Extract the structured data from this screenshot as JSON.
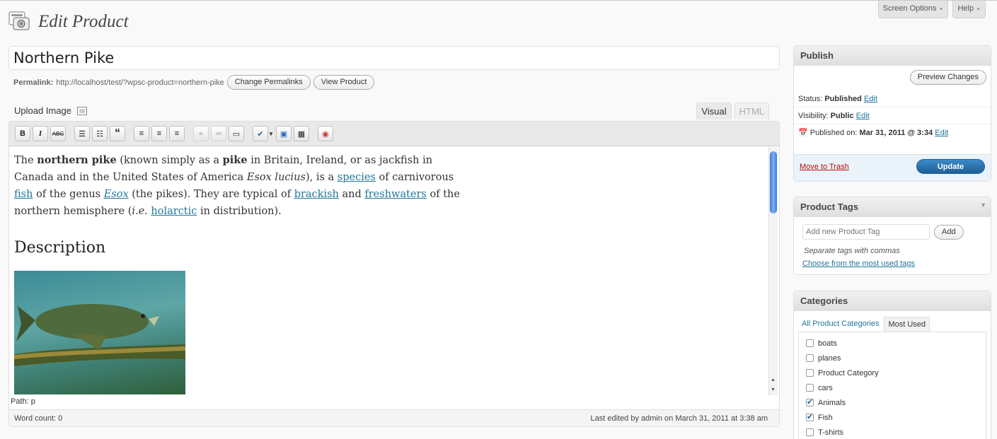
{
  "header": {
    "screen_options": "Screen Options",
    "help": "Help",
    "title": "Edit Product"
  },
  "post": {
    "title": "Northern Pike",
    "permalink_label": "Permalink:",
    "permalink_url": "http://localhost/test/?wpsc-product=northern-pike",
    "change_permalinks": "Change Permalinks",
    "view_product": "View Product"
  },
  "editor": {
    "upload_image": "Upload Image",
    "tab_visual": "Visual",
    "tab_html": "HTML",
    "path": "Path: p",
    "word_count": "Word count: 0",
    "last_edited": "Last edited by admin on March 31, 2011 at 3:38 am",
    "content": {
      "p1": "The",
      "b1": "northern pike",
      "p2": "(known simply as a",
      "b2": "pike",
      "p3": "in Britain, Ireland, or as jackfish in Canada and in the United States of America",
      "i1": "Esox lucius",
      "p4": "), is a",
      "a1": "species",
      "p5": "of carnivorous",
      "a2": "fish",
      "p6": "of the genus",
      "a3": "Esox",
      "p7": "(the pikes). They are typical of",
      "a4": "brackish",
      "p8": "and",
      "a5": "freshwaters",
      "p9": "of the northern hemisphere (",
      "i2": "i.e.",
      "a6": "holarctic",
      "p10": "in distribution).",
      "heading": "Description"
    }
  },
  "publish": {
    "title": "Publish",
    "preview": "Preview Changes",
    "status_label": "Status:",
    "status_value": "Published",
    "visibility_label": "Visibility:",
    "visibility_value": "Public",
    "published_label": "Published on:",
    "published_value": "Mar 31, 2011 @ 3:34",
    "edit": "Edit",
    "trash": "Move to Trash",
    "update": "Update"
  },
  "tags": {
    "title": "Product Tags",
    "placeholder": "Add new Product Tag",
    "add": "Add",
    "hint": "Separate tags with commas",
    "choose": "Choose from the most used tags"
  },
  "categories": {
    "title": "Categories",
    "tab_all": "All Product Categories",
    "tab_most": "Most Used",
    "items": [
      {
        "label": "boats",
        "checked": false
      },
      {
        "label": "planes",
        "checked": false
      },
      {
        "label": "Product Category",
        "checked": false
      },
      {
        "label": "cars",
        "checked": false
      },
      {
        "label": "Animals",
        "checked": true
      },
      {
        "label": "Fish",
        "checked": true
      },
      {
        "label": "T-shirts",
        "checked": false
      }
    ]
  }
}
